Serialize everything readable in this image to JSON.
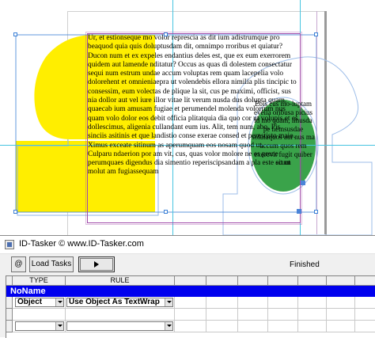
{
  "document": {
    "paragraphs": [
      "Ur, et estionseque mo volor represcia as dit ium adistrumque pro beaquod quia quis doluptusdam dit, omnimpo rroribus et quiatur? Ducon num et ex expeles endantius deles est, que ex eum exerrorem quidem aut lamende nditatur? Occus as quas di dolestem consectatur sequi num estrum undae accum voluptas rem quam lacepelia volo dolorehent et omnieniaepra ut volendebis ellora nimilia plis tincipic to consessim, eum volectas de plique la sit, cus pe maximi, officist, sus nia dollor aut vel iure illor vitae lit verum nusda dus dolupta quam, quaecab ium amusam fugiae et perumendel molenda volorrum nus quam volo dolor eos debit officia plitatquia dia quo cor ut volupis et es dollescimus, aligenia cullandant eum ius. Alit, tem num, abo. Pis sinciis asitinis et que landistio conse exerae consed et perestisto maio. Ximus exceate sitinum as aperumquam eos nosam quod ut.",
      "Culparu ndaerion por am vit, cus, quas volor molore ne es prene perumquaes digendus dia simentio reperiscipsandam a pla este sit ut molut am fugiassequam"
    ],
    "ellipse_text": "Ebis cus mo-luptam evella oribusa picius id mo quam, imusda pe nemsusdae solutaquos aut nus ma accum quos rem exercvit fugit quiber ecum"
  },
  "colors": {
    "yellow_shape": "#ffee00",
    "green_ellipse": "#3aa34a",
    "frame_purple": "#a04aa8",
    "guide_cyan": "#46c4e0",
    "group_row_blue": "#0000ee"
  },
  "panel": {
    "title": "ID-Tasker © www.ID-Tasker.com",
    "at_button": "@",
    "load_tasks_button": "Load Tasks",
    "run_icon": "play-icon",
    "status": "Finished",
    "columns": [
      "TYPE",
      "RULE"
    ],
    "group_name": "NoName",
    "rows": [
      {
        "type": "Object",
        "rule": "Use Object As TextWrap"
      },
      {
        "type": "",
        "rule": ""
      }
    ]
  }
}
